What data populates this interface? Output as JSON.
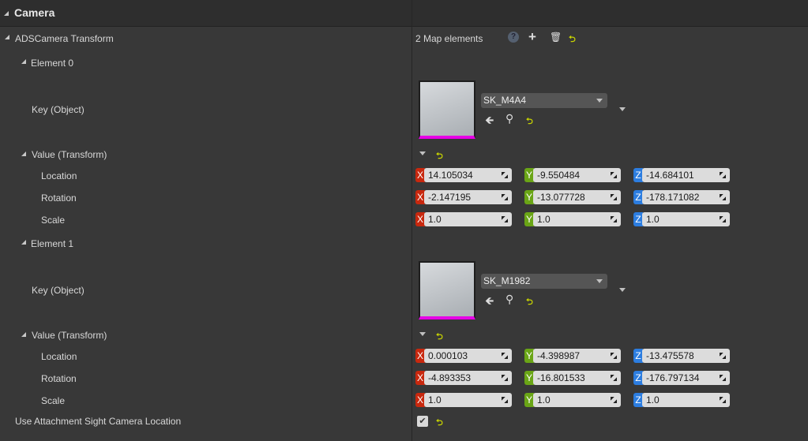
{
  "header": {
    "title": "Camera"
  },
  "property": {
    "label": "ADSCamera Transform",
    "count": "2 Map elements"
  },
  "elements": [
    {
      "label": "Element 0",
      "key_label": "Key (Object)",
      "asset": "SK_M4A4",
      "value_label": "Value (Transform)",
      "rows": [
        {
          "label": "Location",
          "x": "14.105034",
          "y": "-9.550484",
          "z": "-14.684101"
        },
        {
          "label": "Rotation",
          "x": "-2.147195",
          "y": "-13.077728",
          "z": "-178.171082"
        },
        {
          "label": "Scale",
          "x": "1.0",
          "y": "1.0",
          "z": "1.0"
        }
      ]
    },
    {
      "label": "Element 1",
      "key_label": "Key (Object)",
      "asset": "SK_M1982",
      "value_label": "Value (Transform)",
      "rows": [
        {
          "label": "Location",
          "x": "0.000103",
          "y": "-4.398987",
          "z": "-13.475578"
        },
        {
          "label": "Rotation",
          "x": "-4.893353",
          "y": "-16.801533",
          "z": "-176.797134"
        },
        {
          "label": "Scale",
          "x": "1.0",
          "y": "1.0",
          "z": "1.0"
        }
      ]
    }
  ],
  "axes": {
    "x": "X",
    "y": "Y",
    "z": "Z"
  },
  "use_attachment": {
    "label": "Use Attachment Sight Camera Location",
    "checked": true
  },
  "icons": {
    "reset": "⮌",
    "check": "✔"
  }
}
